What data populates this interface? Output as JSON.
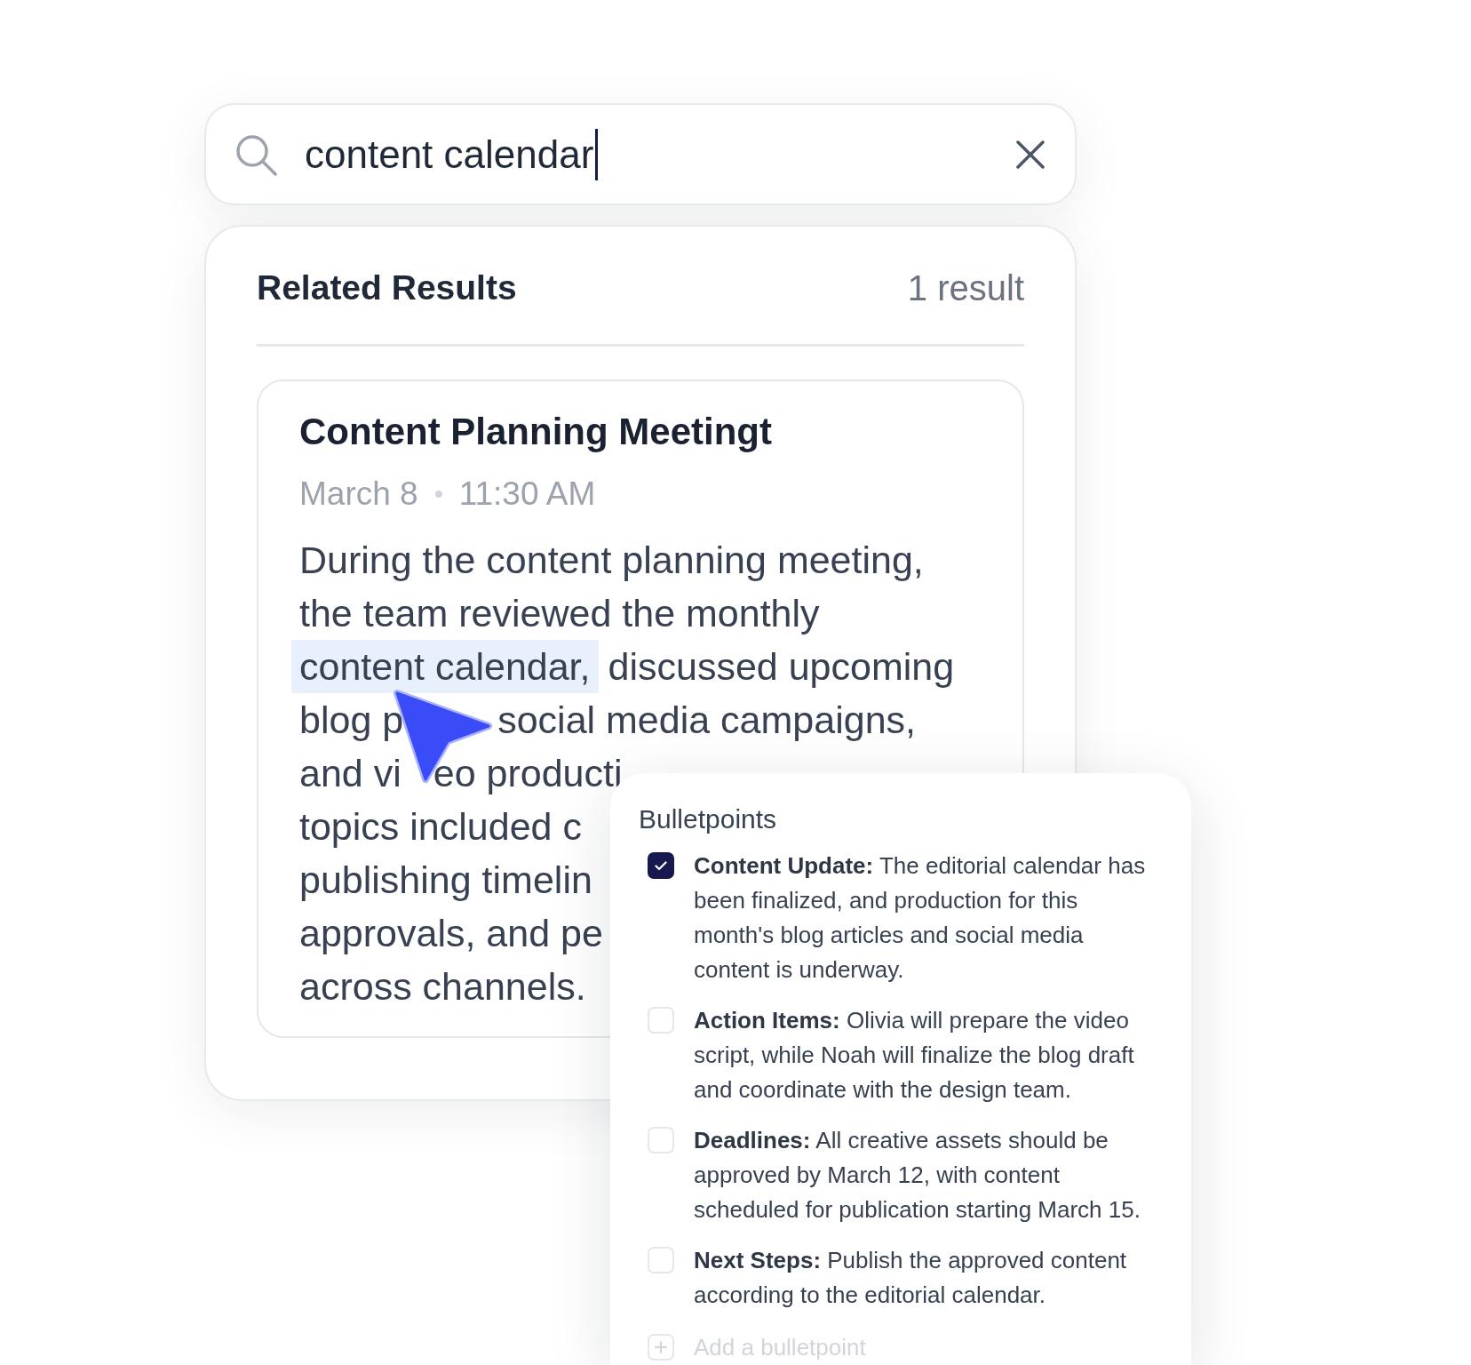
{
  "search": {
    "value": "content calendar",
    "focused": true
  },
  "results": {
    "title": "Related Results",
    "count": "1 result",
    "items": [
      {
        "title": "Content Planning Meetingt",
        "date": "March 8",
        "time": "11:30 AM",
        "body": [
          {
            "segments": [
              {
                "text": "During the content planning meeting,",
                "highlighted": false
              }
            ]
          },
          {
            "segments": [
              {
                "text": "the team reviewed the monthly",
                "highlighted": false
              }
            ]
          },
          {
            "segments": [
              {
                "text": "content calendar,",
                "highlighted": true
              },
              {
                "text": "discussed upcoming",
                "highlighted": false
              }
            ]
          },
          {
            "segments": [
              {
                "text": "blog p",
                "highlighted": false
              },
              {
                "text": "social media campaigns,",
                "highlighted": false
              }
            ]
          },
          {
            "segments": [
              {
                "text": "and vi",
                "highlighted": false
              },
              {
                "text": "eo producti",
                "highlighted": false
              }
            ]
          },
          {
            "segments": [
              {
                "text": "topics included c",
                "highlighted": false
              }
            ]
          },
          {
            "segments": [
              {
                "text": "publishing timelin",
                "highlighted": false
              }
            ]
          },
          {
            "segments": [
              {
                "text": "approvals, and pe",
                "highlighted": false
              }
            ]
          },
          {
            "segments": [
              {
                "text": "across channels.",
                "highlighted": false
              }
            ]
          }
        ]
      }
    ]
  },
  "bulletpoints": {
    "title": "Bulletpoints",
    "items": [
      {
        "text": "**Content Update:** The editorial calendar has been finalized, and production for this month's blog articles and social media content is underway.",
        "checked": true
      },
      {
        "text": "**Action Items:** Olivia will prepare the video script, while Noah will finalize the blog draft and coordinate with the design team.",
        "checked": false
      },
      {
        "text": "**Deadlines:** All creative assets should be approved by March 12, with content scheduled for publication starting March 15.",
        "checked": false
      },
      {
        "text": "**Next Steps:** Publish the approved content according to the editorial calendar.",
        "checked": false
      }
    ],
    "add_label": "Add a bulletpoint"
  }
}
